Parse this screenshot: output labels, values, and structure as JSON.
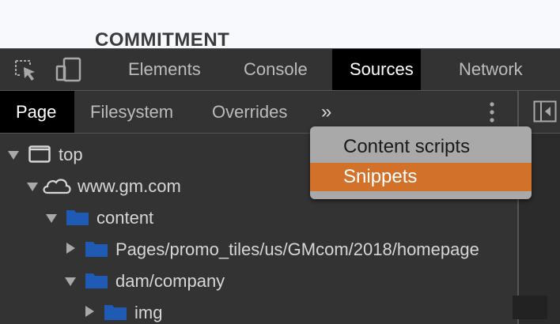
{
  "webpage": {
    "heading": "COMMITMENT"
  },
  "main_tabs": [
    "Elements",
    "Console",
    "Sources",
    "Network"
  ],
  "main_active": "Sources",
  "sub_tabs": [
    "Page",
    "Filesystem",
    "Overrides"
  ],
  "sub_active": "Page",
  "more_tabs_glyph": "»",
  "tree": [
    {
      "label": "top",
      "icon": "frame-icon",
      "expanded": true
    },
    {
      "label": "www.gm.com",
      "icon": "cloud-icon",
      "expanded": true
    },
    {
      "label": "content",
      "icon": "folder-icon",
      "expanded": true
    },
    {
      "label": "Pages/promo_tiles/us/GMcom/2018/homepage",
      "icon": "folder-icon",
      "expanded": false
    },
    {
      "label": "dam/company",
      "icon": "folder-icon",
      "expanded": true
    },
    {
      "label": "img",
      "icon": "folder-icon",
      "expanded": false
    }
  ],
  "popup_menu": {
    "items": [
      "Content scripts",
      "Snippets"
    ],
    "highlighted": "Snippets"
  },
  "colors": {
    "panel_bg": "#333333",
    "active_tab": "#000000",
    "highlight": "#d2722a",
    "menu_bg": "#a9a9a9",
    "folder": "#1f5ab5"
  }
}
